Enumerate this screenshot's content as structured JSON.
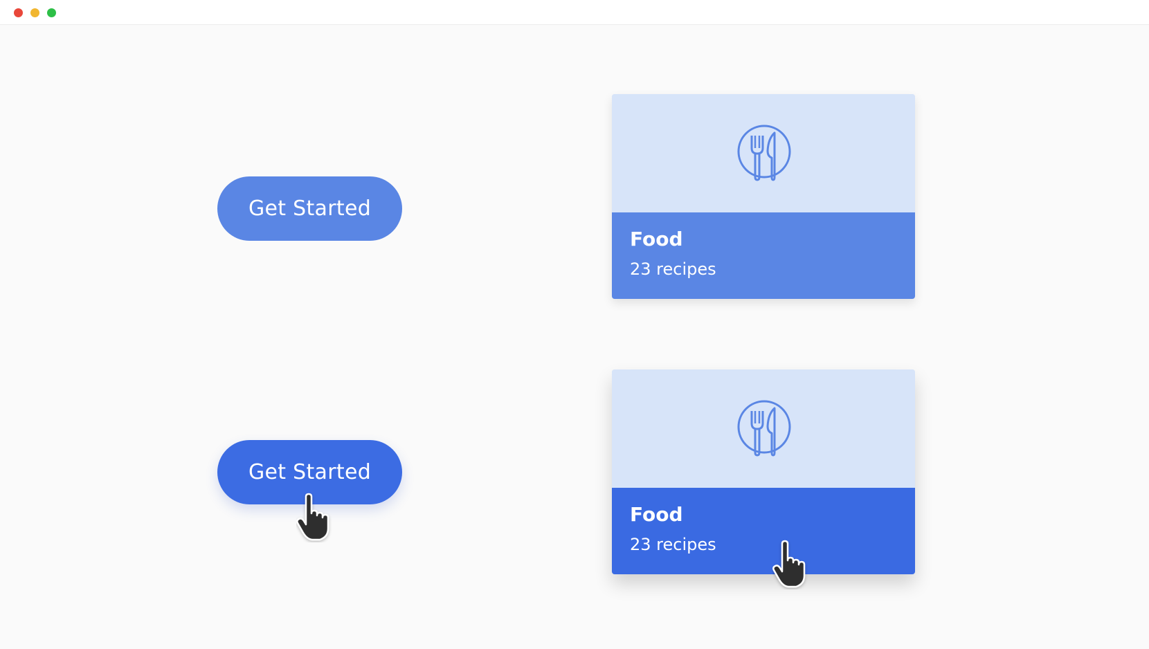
{
  "window": {
    "controls": [
      "close",
      "minimize",
      "maximize"
    ]
  },
  "buttons": {
    "normal_label": "Get Started",
    "hover_label": "Get Started"
  },
  "cards": [
    {
      "state": "normal",
      "icon": "fork-knife-plate-icon",
      "title": "Food",
      "subtitle": "23 recipes"
    },
    {
      "state": "hover",
      "icon": "fork-knife-plate-icon",
      "title": "Food",
      "subtitle": "23 recipes"
    }
  ],
  "colors": {
    "button_normal": "#5a86e4",
    "button_hover": "#3c6ce3",
    "card_top": "#d7e4f9",
    "card_bottom_normal": "#5a86e4",
    "card_bottom_hover": "#3a6ae2",
    "icon_stroke": "#5a86e4"
  }
}
